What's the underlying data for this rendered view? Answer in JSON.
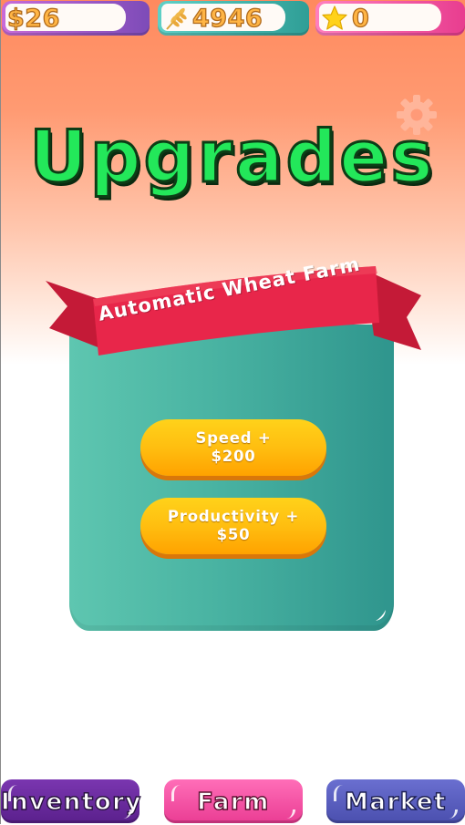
{
  "stats": {
    "money": "$26",
    "wheat": "4946",
    "stars": "0"
  },
  "icons": {
    "wheat": "wheat-icon",
    "star": "star-icon",
    "settings": "gear-icon"
  },
  "title": "Upgrades",
  "card": {
    "ribbon_title": "Automatic Wheat Farm",
    "speed_label": "Speed +",
    "speed_price": "$200",
    "productivity_label": "Productivity +",
    "productivity_price": "$50"
  },
  "nav": {
    "inventory": "Inventory",
    "farm": "Farm",
    "market": "Market"
  },
  "colors": {
    "title_green": "#23e85a",
    "card_teal": "#49b3a2",
    "ribbon_red": "#e8264a",
    "button_orange": "#ffbe10"
  }
}
